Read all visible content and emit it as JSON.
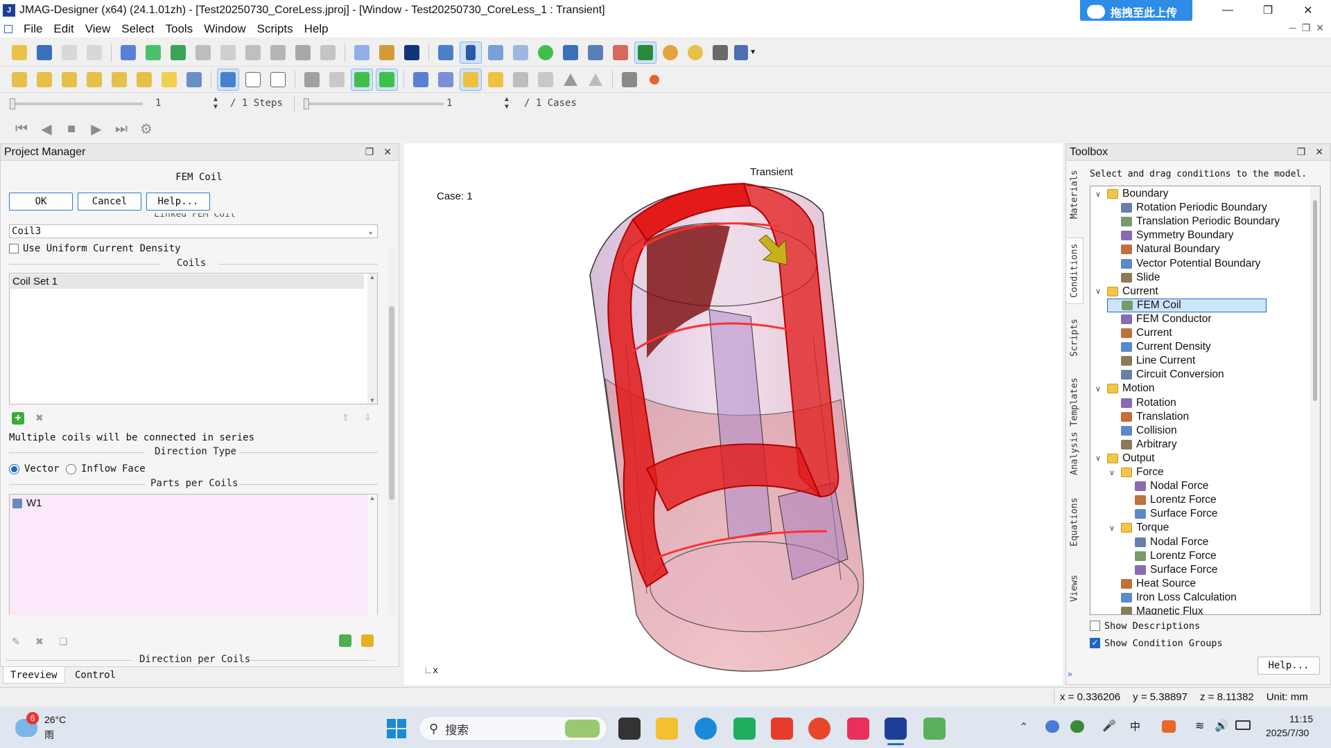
{
  "window": {
    "title": "JMAG-Designer (x64) (24.1.01zh) - [Test20250730_CoreLess.jproj] - [Window - Test20250730_CoreLess_1 : Transient]",
    "upload_badge": "拖拽至此上传"
  },
  "menu": [
    "File",
    "Edit",
    "View",
    "Select",
    "Tools",
    "Window",
    "Scripts",
    "Help"
  ],
  "stepbar": {
    "step_value": "1",
    "steps_label": "/ 1 Steps",
    "case_value": "1",
    "cases_label": "/ 1 Cases"
  },
  "project_manager": {
    "header": "Project Manager",
    "form_title": "FEM Coil",
    "ok": "OK",
    "cancel": "Cancel",
    "help": "Help...",
    "linked_label": "Linked FEM Coil",
    "coil_select": "Coil3",
    "uniform_density": "Use Uniform Current Density",
    "coils_label": "Coils",
    "coil_set": "Coil Set 1",
    "series_note": "Multiple coils will be connected in series",
    "direction_type_label": "Direction Type",
    "vector": "Vector",
    "inflow_face": "Inflow Face",
    "parts_label": "Parts per Coils",
    "part_w1": "W1",
    "direction_per_coils": "Direction per Coils",
    "tab_treeview": "Treeview",
    "tab_control": "Control"
  },
  "viewport": {
    "title": "Transient",
    "case": "Case: 1",
    "axis_label": "x"
  },
  "toolbox": {
    "header": "Toolbox",
    "hint": "Select and drag conditions to the model.",
    "vtabs": [
      "Materials",
      "Conditions",
      "Scripts",
      "Analysis Templates",
      "Equations",
      "Views"
    ],
    "tree": [
      {
        "label": "Boundary",
        "level": 0,
        "folder": true,
        "expanded": true
      },
      {
        "label": "Rotation Periodic Boundary",
        "level": 1
      },
      {
        "label": "Translation Periodic Boundary",
        "level": 1
      },
      {
        "label": "Symmetry Boundary",
        "level": 1
      },
      {
        "label": "Natural Boundary",
        "level": 1
      },
      {
        "label": "Vector Potential Boundary",
        "level": 1
      },
      {
        "label": "Slide",
        "level": 1
      },
      {
        "label": "Current",
        "level": 0,
        "folder": true,
        "expanded": true
      },
      {
        "label": "FEM Coil",
        "level": 1,
        "selected": true
      },
      {
        "label": "FEM Conductor",
        "level": 1
      },
      {
        "label": "Current",
        "level": 1
      },
      {
        "label": "Current Density",
        "level": 1
      },
      {
        "label": "Line Current",
        "level": 1
      },
      {
        "label": "Circuit Conversion",
        "level": 1
      },
      {
        "label": "Motion",
        "level": 0,
        "folder": true,
        "expanded": true
      },
      {
        "label": "Rotation",
        "level": 1
      },
      {
        "label": "Translation",
        "level": 1
      },
      {
        "label": "Collision",
        "level": 1
      },
      {
        "label": "Arbitrary",
        "level": 1
      },
      {
        "label": "Output",
        "level": 0,
        "folder": true,
        "expanded": true
      },
      {
        "label": "Force",
        "level": 1,
        "folder": true,
        "expanded": true
      },
      {
        "label": "Nodal Force",
        "level": 2
      },
      {
        "label": "Lorentz Force",
        "level": 2
      },
      {
        "label": "Surface Force",
        "level": 2
      },
      {
        "label": "Torque",
        "level": 1,
        "folder": true,
        "expanded": true
      },
      {
        "label": "Nodal Force",
        "level": 2
      },
      {
        "label": "Lorentz Force",
        "level": 2
      },
      {
        "label": "Surface Force",
        "level": 2
      },
      {
        "label": "Heat Source",
        "level": 1
      },
      {
        "label": "Iron Loss Calculation",
        "level": 1
      },
      {
        "label": "Magnetic Flux",
        "level": 1
      }
    ],
    "show_descriptions": "Show Descriptions",
    "show_condition_groups": "Show Condition Groups",
    "show_descriptions_checked": false,
    "show_condition_groups_checked": true,
    "help": "Help..."
  },
  "statusbar": {
    "x": "x = 0.336206",
    "y": "y = 5.38897",
    "z": "z = 8.11382",
    "unit": "Unit: mm"
  },
  "taskbar": {
    "weather_badge": "6",
    "temperature": "26°C",
    "weather": "雨",
    "search_placeholder": "搜索",
    "time": "11:15",
    "date": "2025/7/30"
  },
  "colors": {
    "accent": "#1e66c8",
    "coil_red": "#e21a1a",
    "parts_bg": "#fbe8fb"
  }
}
